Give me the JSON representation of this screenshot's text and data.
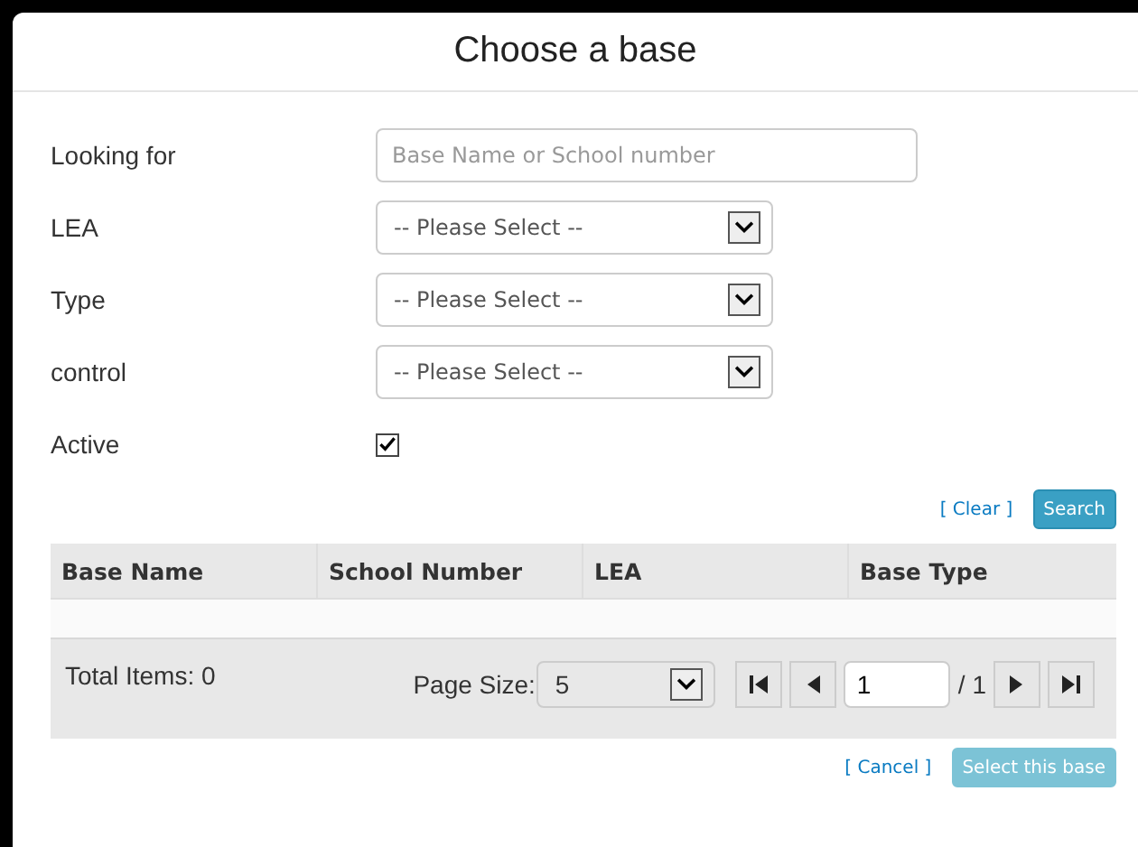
{
  "dialog": {
    "title": "Choose a base"
  },
  "fields": [
    {
      "kind": "text",
      "label": "Looking for",
      "placeholder": "Base Name or School number"
    },
    {
      "kind": "select",
      "label": "LEA",
      "value": "-- Please Select --"
    },
    {
      "kind": "select",
      "label": "Type",
      "value": "-- Please Select --"
    },
    {
      "kind": "select",
      "label": "control",
      "value": "-- Please Select --"
    },
    {
      "kind": "checkbox",
      "label": "Active",
      "checked": true
    }
  ],
  "search_actions": {
    "clear_link": "[ Clear ]",
    "search_button": "Search"
  },
  "table": {
    "columns": [
      "Base Name",
      "School Number",
      "LEA",
      "Base Type"
    ]
  },
  "pager": {
    "total": "Total Items: 0",
    "page_size_label": "Page Size:",
    "page_size": "5",
    "page": "1",
    "page_count": "/ 1"
  },
  "footer": {
    "cancel_link": "[ Cancel ]",
    "select_button": {
      "label": "Select this base",
      "disabled": true
    }
  }
}
